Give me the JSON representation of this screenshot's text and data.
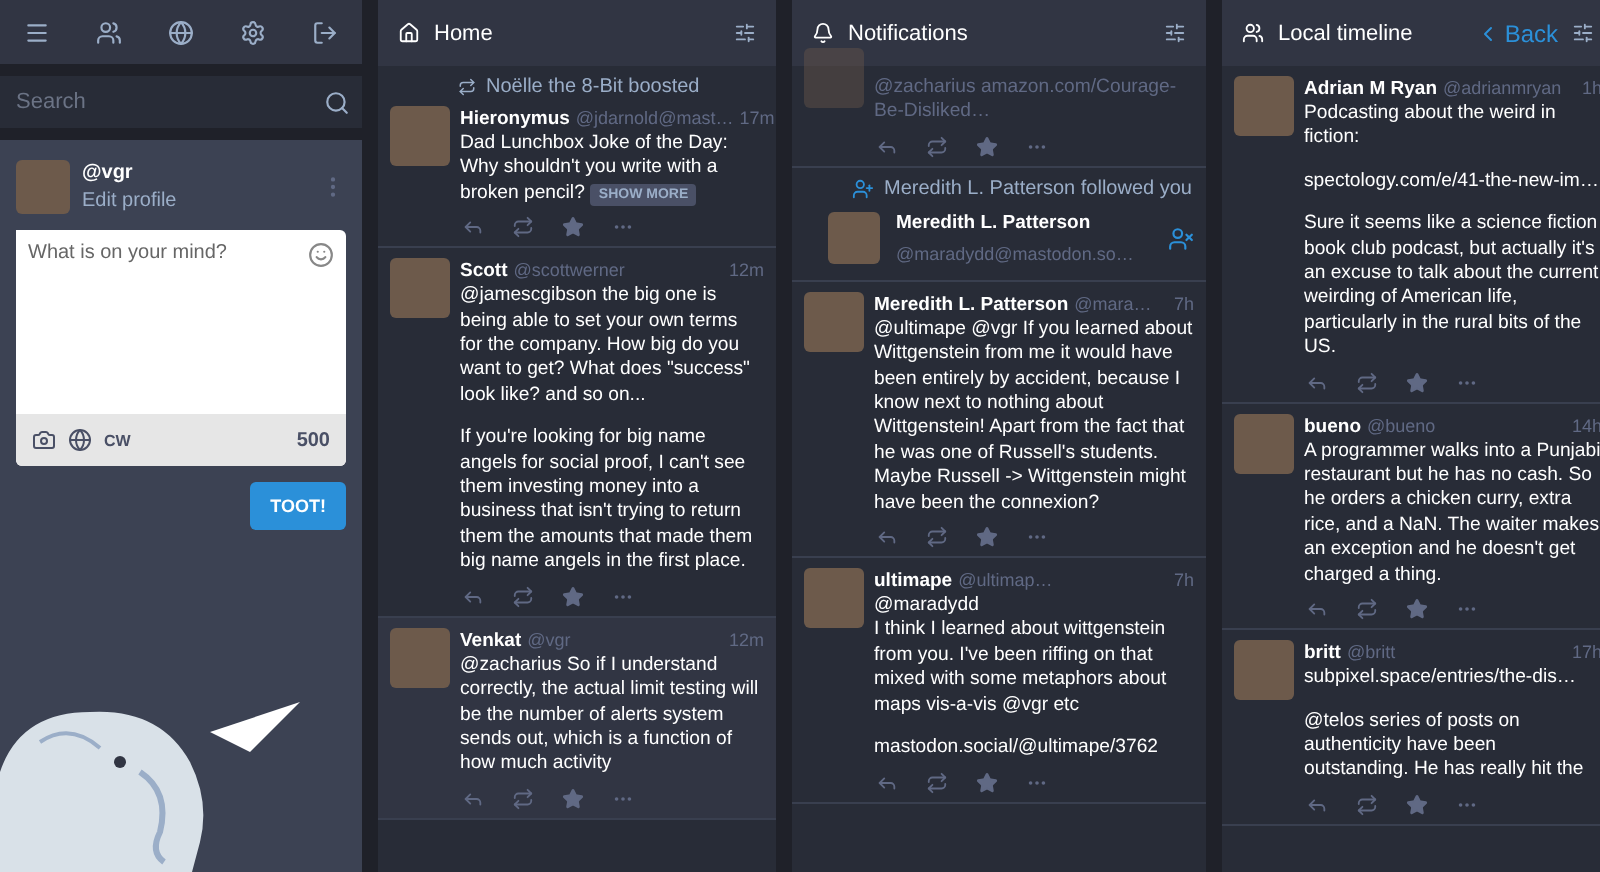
{
  "search": {
    "placeholder": "Search"
  },
  "profile": {
    "handle": "@vgr",
    "link": "Edit profile"
  },
  "compose": {
    "placeholder": "What is on your mind?",
    "cw": "CW",
    "counter": "500",
    "submit": "TOOT!"
  },
  "columns": [
    {
      "kind": "home",
      "title": "Home",
      "items": [
        {
          "kind": "status",
          "boosted_by": "Noëlle the 8-Bit",
          "boost_label": "boosted",
          "name": "Hieronymus",
          "handle": "@jdarnold@mast…",
          "time": "17m",
          "paragraphs": [
            "Dad Lunchbox Joke of the Day: Why shouldn't you write with a broken pencil?"
          ],
          "show_more": "SHOW MORE"
        },
        {
          "kind": "status",
          "name": "Scott",
          "handle": "@scottwerner",
          "time": "12m",
          "paragraphs": [
            "@jamescgibson the big one is being able to set your own terms for the company. How big do you want to get? What does \"success\" look like? and so on...",
            "If you're looking for big name angels for social proof, I can't see them investing money into a business that isn't trying to return them the amounts that made them big name angels in the first place."
          ]
        },
        {
          "kind": "status",
          "highlighted": true,
          "name": "Venkat",
          "handle": "@vgr",
          "time": "12m",
          "paragraphs": [
            "@zacharius So if I understand correctly, the actual limit testing will be the number of alerts system sends out, which is a function of how much activity"
          ]
        }
      ]
    },
    {
      "kind": "notifications",
      "title": "Notifications",
      "items": [
        {
          "kind": "status",
          "dim": true,
          "paragraphs": [
            "@zacharius amazon.com/Courage-Be-Disliked…"
          ]
        },
        {
          "kind": "follow",
          "text": "Meredith L. Patterson followed you",
          "name": "Meredith L. Patterson",
          "handle": "@maradydd@mastodon.so…"
        },
        {
          "kind": "status",
          "name": "Meredith L. Patterson",
          "handle": "@mara…",
          "time": "7h",
          "paragraphs": [
            "@ultimape @vgr  If you learned about Wittgenstein from me it would have been entirely by accident, because I know next to nothing about Wittgenstein! Apart from the fact that he was one of Russell's students. Maybe Russell -> Wittgenstein might have been the connexion?"
          ]
        },
        {
          "kind": "status",
          "name": "ultimape",
          "handle": "@ultimap…",
          "time": "7h",
          "paragraphs": [
            "@maradydd\nI think I learned about wittgenstein from you. I've been riffing on that mixed with some metaphors about maps vis-a-vis @vgr  etc",
            "mastodon.social/@ultimape/3762"
          ]
        }
      ]
    },
    {
      "kind": "local",
      "title": "Local timeline",
      "back": "Back",
      "items": [
        {
          "kind": "status",
          "name": "Adrian M Ryan",
          "handle": "@adrianmryan",
          "time": "1h",
          "paragraphs": [
            "Podcasting about the weird in fiction:",
            "spectology.com/e/41-the-new-im…",
            "Sure it seems like a science fiction book club podcast, but actually it's an excuse to talk about the current weirding of American life, particularly in the rural bits of the US."
          ]
        },
        {
          "kind": "status",
          "name": "bueno",
          "handle": "@bueno",
          "time": "14h",
          "paragraphs": [
            "A programmer walks into a Punjabi restaurant but he has no cash. So he orders a chicken curry, extra rice, and a NaN. The waiter makes an exception and he doesn't get charged a thing."
          ]
        },
        {
          "kind": "status",
          "name": "britt",
          "handle": "@britt",
          "time": "17h",
          "paragraphs": [
            "subpixel.space/entries/the-dis…",
            "@telos series of posts on authenticity have been outstanding. He has really hit the"
          ]
        }
      ]
    }
  ]
}
